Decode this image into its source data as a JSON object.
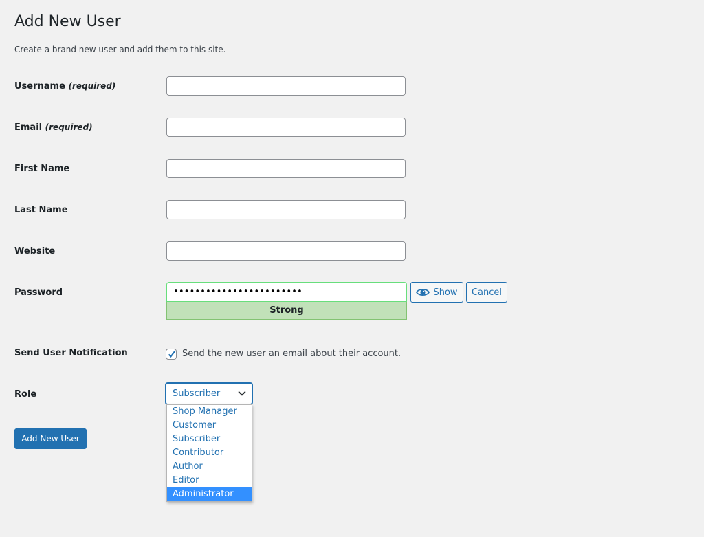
{
  "page": {
    "title": "Add New User",
    "intro": "Create a brand new user and add them to this site."
  },
  "form": {
    "username": {
      "label": "Username",
      "required_note": "(required)",
      "value": ""
    },
    "email": {
      "label": "Email",
      "required_note": "(required)",
      "value": ""
    },
    "first_name": {
      "label": "First Name",
      "value": ""
    },
    "last_name": {
      "label": "Last Name",
      "value": ""
    },
    "website": {
      "label": "Website",
      "value": ""
    },
    "password": {
      "label": "Password",
      "value": "••••••••••••••••••••••••",
      "strength": "Strong",
      "show_label": "Show",
      "cancel_label": "Cancel"
    },
    "notification": {
      "label": "Send User Notification",
      "checkbox_label": "Send the new user an email about their account.",
      "checked": true
    },
    "role": {
      "label": "Role",
      "selected": "Subscriber",
      "options": [
        "Shop Manager",
        "Customer",
        "Subscriber",
        "Contributor",
        "Author",
        "Editor",
        "Administrator"
      ],
      "highlighted": "Administrator"
    },
    "submit_label": "Add New User"
  },
  "colors": {
    "accent": "#2271b1",
    "strong_bg": "#c1e1b9",
    "highlight": "#3390ff",
    "background": "#f1f1f1"
  },
  "icons": {
    "show": "eye-icon",
    "checkbox": "checkmark-icon",
    "select": "chevron-down-icon"
  }
}
